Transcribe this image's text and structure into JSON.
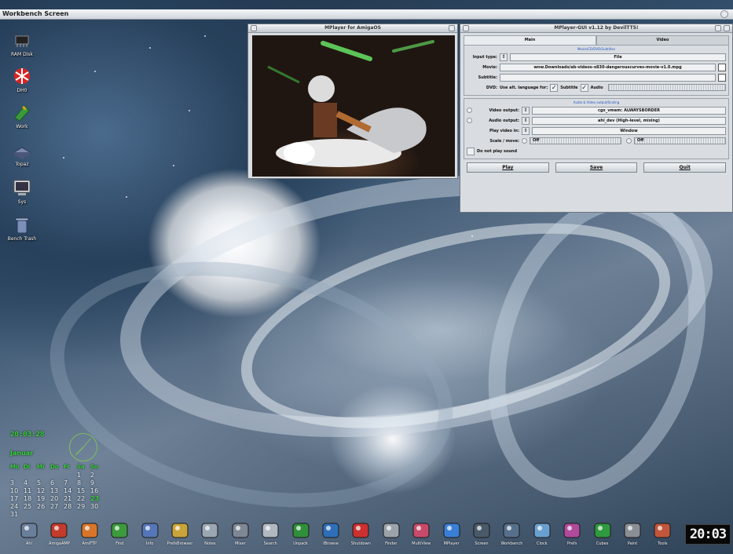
{
  "screen": {
    "title": "Workbench Screen"
  },
  "desktop_icons": [
    {
      "label": "RAM Disk",
      "icon": "ram-chip-icon"
    },
    {
      "label": "DH0",
      "icon": "boing-ball-disk-icon"
    },
    {
      "label": "Work",
      "icon": "green-disk-icon"
    },
    {
      "label": "Topaz",
      "icon": "drive-icon"
    },
    {
      "label": "Sys",
      "icon": "monitor-icon"
    },
    {
      "label": "Bench Trash",
      "icon": "trashcan-icon"
    }
  ],
  "video_window": {
    "title": "MPlayer for AmigaOS"
  },
  "mplayer_gui": {
    "title": "MPlayer-GUI v1.12 by DevilTT5!",
    "tabs": [
      "Main",
      "Video"
    ],
    "movie_group_title": "Movie/CD/DVD/Subtitles",
    "input_type": {
      "label": "Input type:",
      "value": "File"
    },
    "movie": {
      "label": "Movie:",
      "value": "wnw.Downloads/ab-videos-x830-dangerouscurves-movie-v1.0.mpg"
    },
    "subtitle": {
      "label": "Subtitle:",
      "value": ""
    },
    "dvd": {
      "label": "DVD:",
      "text": "Use alt. language for:",
      "subtitle_label": "Subtitle",
      "audio_label": "Audio",
      "subtitle_checked": true,
      "audio_checked": true
    },
    "av_group_title": "Audio & Video output/Scaling",
    "video_output": {
      "label": "Video output:",
      "value": "cgx_vmem: ALWAYSBORDER"
    },
    "audio_output": {
      "label": "Audio output:",
      "value": "ahi_dev (High-level, mixing)"
    },
    "play_video_in": {
      "label": "Play video in:",
      "value": "Window"
    },
    "scale_move": {
      "label": "Scale / move:",
      "left_value": "Off",
      "right_value": "Off"
    },
    "no_sound": {
      "label": "Do not play sound",
      "checked": false
    },
    "buttons": [
      "Play",
      "Save",
      "Quit"
    ]
  },
  "calendar": {
    "time": "20:03:28",
    "month": "Januar",
    "weekdays": [
      "Mo",
      "Di",
      "Mi",
      "Do",
      "Fr",
      "Sa",
      "So"
    ],
    "weeks": [
      [
        "",
        "",
        "",
        "",
        "",
        "1",
        "2"
      ],
      [
        "3",
        "4",
        "5",
        "6",
        "7",
        "8",
        "9"
      ],
      [
        "10",
        "11",
        "12",
        "13",
        "14",
        "15",
        "16"
      ],
      [
        "17",
        "18",
        "19",
        "20",
        "21",
        "22",
        "23"
      ],
      [
        "24",
        "25",
        "26",
        "27",
        "28",
        "29",
        "30"
      ],
      [
        "31",
        "",
        "",
        "",
        "",
        "",
        ""
      ]
    ],
    "today": "23"
  },
  "dock": {
    "items": [
      {
        "label": "Ahi",
        "icon": "speaker-icon"
      },
      {
        "label": "AmigaAMP",
        "icon": "amp-logo-icon"
      },
      {
        "label": "AmiFTP",
        "icon": "globe-tool-icon"
      },
      {
        "label": "Find",
        "icon": "flashlight-icon"
      },
      {
        "label": "Info",
        "icon": "document-icon"
      },
      {
        "label": "PrefsBrowser",
        "icon": "pencil-folder-icon"
      },
      {
        "label": "Notes",
        "icon": "satellite-icon"
      },
      {
        "label": "Mixer",
        "icon": "mixer-sliders-icon"
      },
      {
        "label": "Search",
        "icon": "magnifier-icon"
      },
      {
        "label": "Unpack",
        "icon": "green-pen-icon"
      },
      {
        "label": "IBrowse",
        "icon": "earth-icon"
      },
      {
        "label": "Shutdown",
        "icon": "red-button-icon"
      },
      {
        "label": "Finder",
        "icon": "magnifier-gray-icon"
      },
      {
        "label": "MultiView",
        "icon": "eye-icon"
      },
      {
        "label": "MPlayer",
        "icon": "disc-icon"
      },
      {
        "label": "Screen",
        "icon": "monitor-icon"
      },
      {
        "label": "Workbench",
        "icon": "terminal-icon"
      },
      {
        "label": "Clock",
        "icon": "calendar-icon"
      },
      {
        "label": "Prefs",
        "icon": "color-prefs-icon"
      },
      {
        "label": "Cubes",
        "icon": "green-cube-icon"
      },
      {
        "label": "Paint",
        "icon": "brush-icon"
      },
      {
        "label": "Tools",
        "icon": "toolbox-icon"
      }
    ],
    "clock": "20:03"
  }
}
